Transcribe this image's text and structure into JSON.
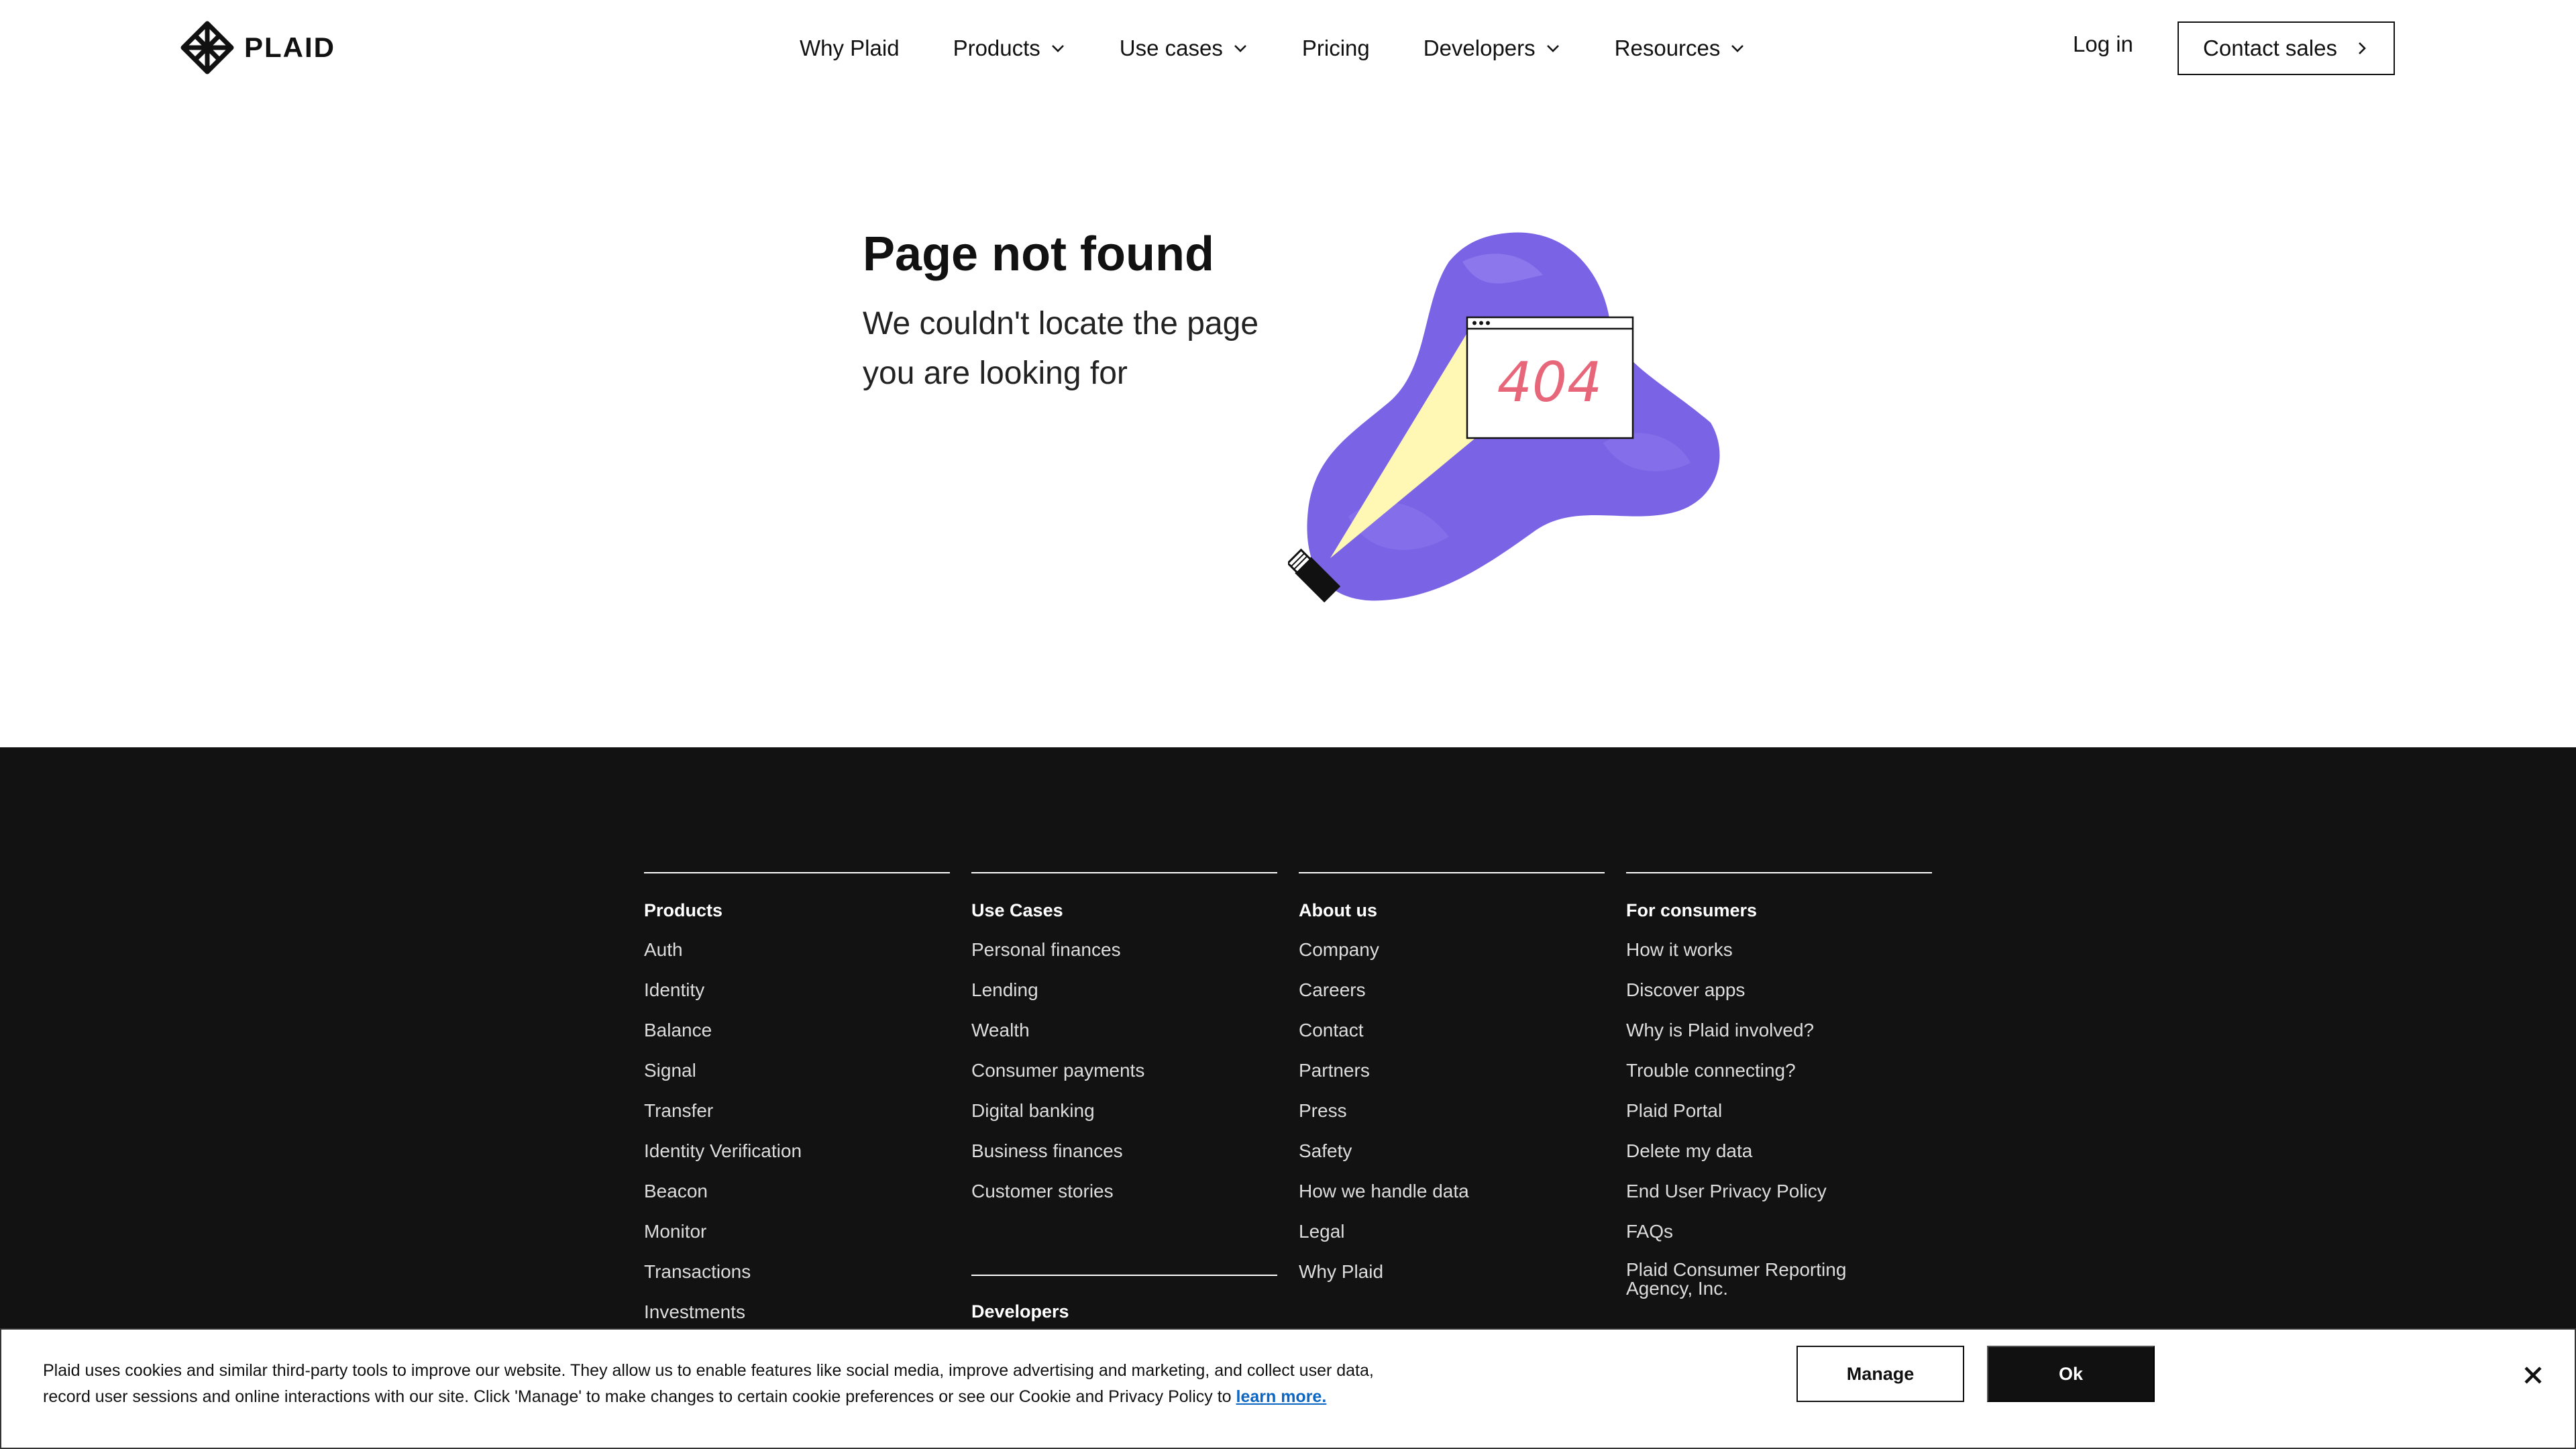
{
  "header": {
    "logo_text": "PLAID",
    "nav": [
      {
        "label": "Why Plaid",
        "has_dropdown": false
      },
      {
        "label": "Products",
        "has_dropdown": true
      },
      {
        "label": "Use cases",
        "has_dropdown": true
      },
      {
        "label": "Pricing",
        "has_dropdown": false
      },
      {
        "label": "Developers",
        "has_dropdown": true
      },
      {
        "label": "Resources",
        "has_dropdown": true
      }
    ],
    "login_label": "Log in",
    "contact_label": "Contact sales"
  },
  "hero": {
    "title": "Page not found",
    "subtitle": "We couldn't locate the page you are looking for",
    "illustration_code": "404"
  },
  "footer": {
    "columns": [
      {
        "heading": "Products",
        "links": [
          "Auth",
          "Identity",
          "Balance",
          "Signal",
          "Transfer",
          "Identity Verification",
          "Beacon",
          "Monitor",
          "Transactions",
          "Investments"
        ]
      },
      {
        "heading": "Use Cases",
        "links": [
          "Personal finances",
          "Lending",
          "Wealth",
          "Consumer payments",
          "Digital banking",
          "Business finances",
          "Customer stories"
        ]
      },
      {
        "heading": "About us",
        "links": [
          "Company",
          "Careers",
          "Contact",
          "Partners",
          "Press",
          "Safety",
          "How we handle data",
          "Legal",
          "Why Plaid"
        ]
      },
      {
        "heading": "For consumers",
        "links": [
          "How it works",
          "Discover apps",
          "Why is Plaid involved?",
          "Trouble connecting?",
          "Plaid Portal",
          "Delete my data",
          "End User Privacy Policy",
          "FAQs",
          "Plaid Consumer Reporting Agency, Inc."
        ]
      }
    ],
    "developers_heading": "Developers"
  },
  "cookie": {
    "text": "Plaid uses cookies and similar third-party tools to improve our website. They allow us to enable features like social media, improve advertising and marketing, and collect user data, record user sessions and online interactions with our site. Click 'Manage' to make changes to certain cookie preferences or see our Cookie and Privacy Policy to",
    "link_label": "learn more.",
    "manage_label": "Manage",
    "ok_label": "Ok"
  },
  "colors": {
    "accent_purple": "#7B63E6",
    "light_yellow": "#FFF8B5",
    "error_pink": "#E8667A",
    "footer_bg": "#121212"
  }
}
